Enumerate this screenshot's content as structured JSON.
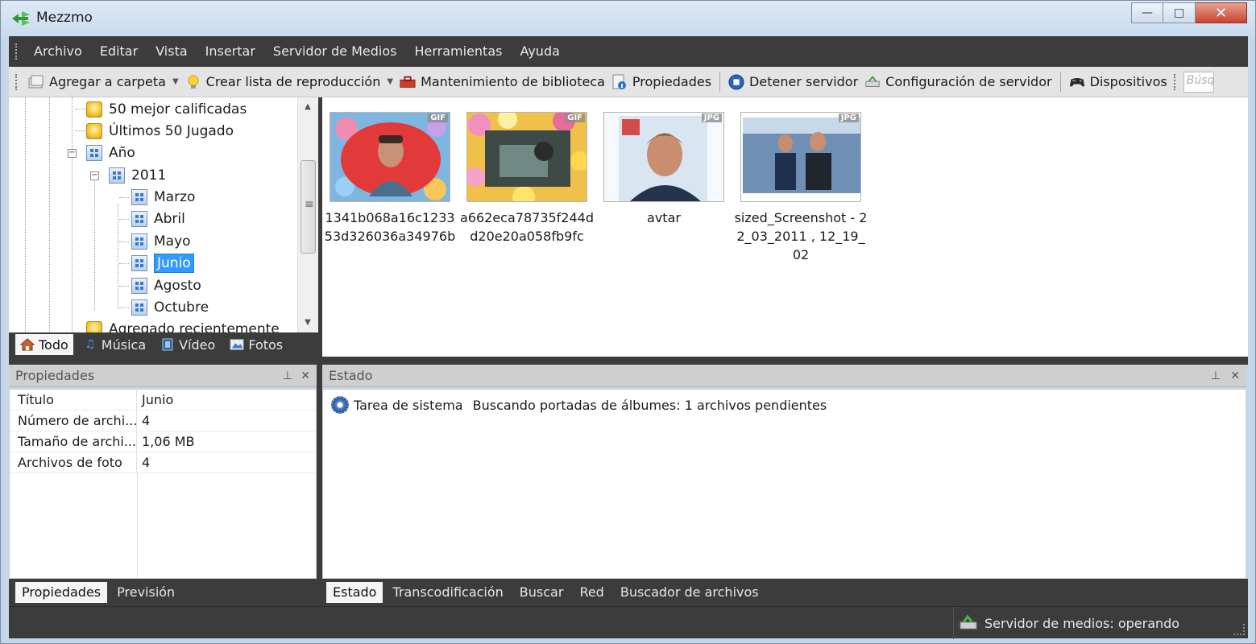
{
  "window": {
    "title": "Mezzmo",
    "minimize": "—",
    "maximize": "□",
    "close": "✕"
  },
  "menu": [
    "Archivo",
    "Editar",
    "Vista",
    "Insertar",
    "Servidor de Medios",
    "Herramientas",
    "Ayuda"
  ],
  "toolbar": {
    "add_folder": "Agregar a carpeta",
    "create_playlist": "Crear lista de reproducción",
    "library_maintenance": "Mantenimiento de biblioteca",
    "properties": "Propiedades",
    "stop_server": "Detener servidor",
    "server_config": "Configuración de servidor",
    "devices": "Dispositivos",
    "search_placeholder": "Búsq"
  },
  "tree": {
    "top_rated": "50 mejor calificadas",
    "last_played": "Últimos 50 Jugado",
    "year": "Año",
    "year_2011": "2011",
    "months": [
      "Marzo",
      "Abril",
      "Mayo",
      "Junio",
      "Agosto",
      "Octubre"
    ],
    "selected": "Junio",
    "recently_added": "Agregado recientemente"
  },
  "tree_tabs": [
    "Todo",
    "Música",
    "Vídeo",
    "Fotos"
  ],
  "thumbnails": [
    {
      "caption": "1341b068a16c123353d326036a34976b",
      "badge": "GIF"
    },
    {
      "caption": "a662eca78735f244dd20e20a058fb9fc",
      "badge": "GIF"
    },
    {
      "caption": "avtar",
      "badge": "JPG"
    },
    {
      "caption": "sized_Screenshot - 22_03_2011 , 12_19_02",
      "badge": "JPG"
    }
  ],
  "properties_panel": {
    "title": "Propiedades",
    "rows": [
      {
        "key": "Título",
        "value": "Junio"
      },
      {
        "key": "Número de archi...",
        "value": "4"
      },
      {
        "key": "Tamaño de archi...",
        "value": "1,06 MB"
      },
      {
        "key": "Archivos de foto",
        "value": "4"
      }
    ],
    "tabs": [
      "Propiedades",
      "Previsión"
    ]
  },
  "status_panel": {
    "title": "Estado",
    "task_label": "Tarea de sistema",
    "task_text": "Buscando portadas de álbumes: 1 archivos pendientes",
    "tabs": [
      "Estado",
      "Transcodificación",
      "Buscar",
      "Red",
      "Buscador de archivos"
    ]
  },
  "statusbar": {
    "server_status": "Servidor de medios: operando"
  },
  "colors": {
    "dark_bar": "#3c3c3c",
    "selection": "#3399ff",
    "window_frame": "#c5d7ea"
  }
}
